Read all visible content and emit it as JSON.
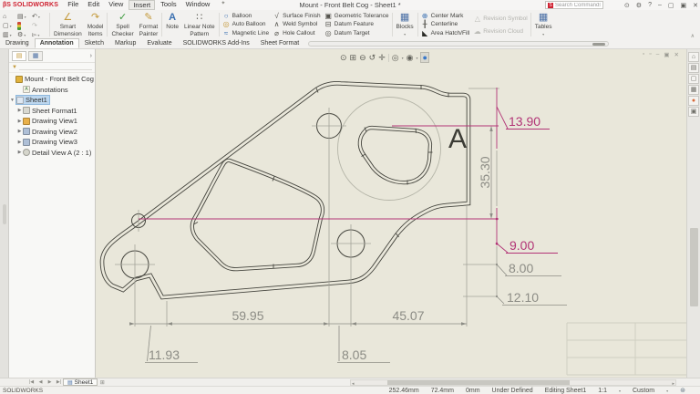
{
  "titlebar": {
    "brand": "SOLIDWORKS",
    "menus": [
      "File",
      "Edit",
      "View",
      "Insert",
      "Tools",
      "Window"
    ],
    "title": "Mount - Front Belt Cog - Sheet1 *",
    "search_placeholder": "Search Commands"
  },
  "ribbon": {
    "qat": {
      "icons": [
        "⌂",
        "▤",
        "↶",
        "▢",
        "▦",
        "↷",
        "▥",
        "⚙",
        "▻"
      ]
    },
    "groups": [
      {
        "items": []
      },
      {
        "items": [
          {
            "label": "Smart\nDimension",
            "icon": "∠"
          },
          {
            "label": "Model\nItems",
            "icon": "↷"
          }
        ]
      },
      {
        "items": [
          {
            "label": "Spell\nChecker",
            "icon": "✓"
          },
          {
            "label": "Format\nPainter",
            "icon": "✎"
          }
        ]
      },
      {
        "items": [
          {
            "label": "Note",
            "icon": "A"
          },
          {
            "label": "Linear Note\nPattern",
            "icon": "∷"
          }
        ]
      },
      {
        "items": [
          {
            "label": "Balloon",
            "icon": "○"
          },
          {
            "label": "Auto Balloon",
            "icon": "◎"
          },
          {
            "label": "Magnetic Line",
            "icon": "≈"
          }
        ]
      },
      {
        "items": [
          {
            "label": "Surface Finish",
            "icon": "√"
          },
          {
            "label": "Weld Symbol",
            "icon": "∧"
          },
          {
            "label": "Hole Callout",
            "icon": "⌀"
          }
        ]
      },
      {
        "items": [
          {
            "label": "Geometric Tolerance",
            "icon": "▣"
          },
          {
            "label": "Datum Feature",
            "icon": "⊟"
          },
          {
            "label": "Datum Target",
            "icon": "◎"
          }
        ]
      },
      {
        "items": [
          {
            "label": "Blocks",
            "icon": "▦"
          }
        ]
      },
      {
        "items": [
          {
            "label": "Center Mark",
            "icon": "⊕"
          },
          {
            "label": "Centerline",
            "icon": "╂"
          },
          {
            "label": "Area Hatch/Fill",
            "icon": "◣"
          }
        ]
      },
      {
        "items": [
          {
            "label": "Revision Symbol",
            "icon": "△"
          },
          {
            "label": "Revision Cloud",
            "icon": "☁"
          }
        ]
      },
      {
        "items": [
          {
            "label": "Tables",
            "icon": "▦"
          }
        ]
      }
    ]
  },
  "tabs": [
    {
      "label": "Drawing"
    },
    {
      "label": "Annotation"
    },
    {
      "label": "Sketch"
    },
    {
      "label": "Markup"
    },
    {
      "label": "Evaluate"
    },
    {
      "label": "SOLIDWORKS Add-Ins"
    },
    {
      "label": "Sheet Format"
    }
  ],
  "tree": {
    "rows": [
      {
        "label": "Mount - Front Belt Cog"
      },
      {
        "label": "Annotations"
      },
      {
        "label": "Sheet1"
      },
      {
        "label": "Sheet Format1"
      },
      {
        "label": "Drawing View1"
      },
      {
        "label": "Drawing View2"
      },
      {
        "label": "Drawing View3"
      },
      {
        "label": "Detail View A (2 : 1)"
      }
    ]
  },
  "drawing": {
    "detail_label": "A",
    "colors": {
      "selected_dim": "#b23476",
      "dim": "#8c8c85",
      "edge": "#45453e"
    },
    "dims": {
      "top_to_hole": "13.90",
      "right_height": "35.30",
      "hole_offset": "9.00",
      "step": "8.00",
      "lower_right": "12.10",
      "span_left": "59.95",
      "span_right": "45.07",
      "notch": "11.93",
      "hole_gap": "8.05"
    }
  },
  "sheetbar": {
    "tab": "Sheet1"
  },
  "statusbar": {
    "app_name": "SOLIDWORKS",
    "x": "252.46mm",
    "y": "72.4mm",
    "z": "0mm",
    "state": "Under Defined",
    "mode": "Editing Sheet1",
    "scale": "1:1",
    "units": "Custom"
  }
}
